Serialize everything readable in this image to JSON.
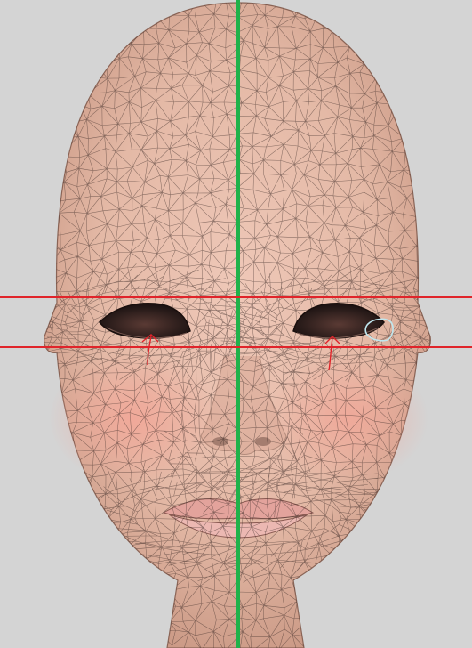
{
  "scene": {
    "subject": "head-mesh",
    "background_color": "#d4d4d4",
    "skin_color": "#e4b9a6",
    "skin_shadow_color": "#c89682",
    "cheek_color": "#f2a898",
    "lip_color": "#e5a9a2",
    "wire_color": "#3a2a26",
    "eye_color": "#2a1c1a"
  },
  "guides": {
    "vertical_centerline_color": "#1fb24a",
    "horizontal_guide_color": "#e0242a",
    "horizontal_guide_count": 2,
    "marker_arrow_color": "#e0242a",
    "selection_outline_color": "#bfe6ee"
  }
}
